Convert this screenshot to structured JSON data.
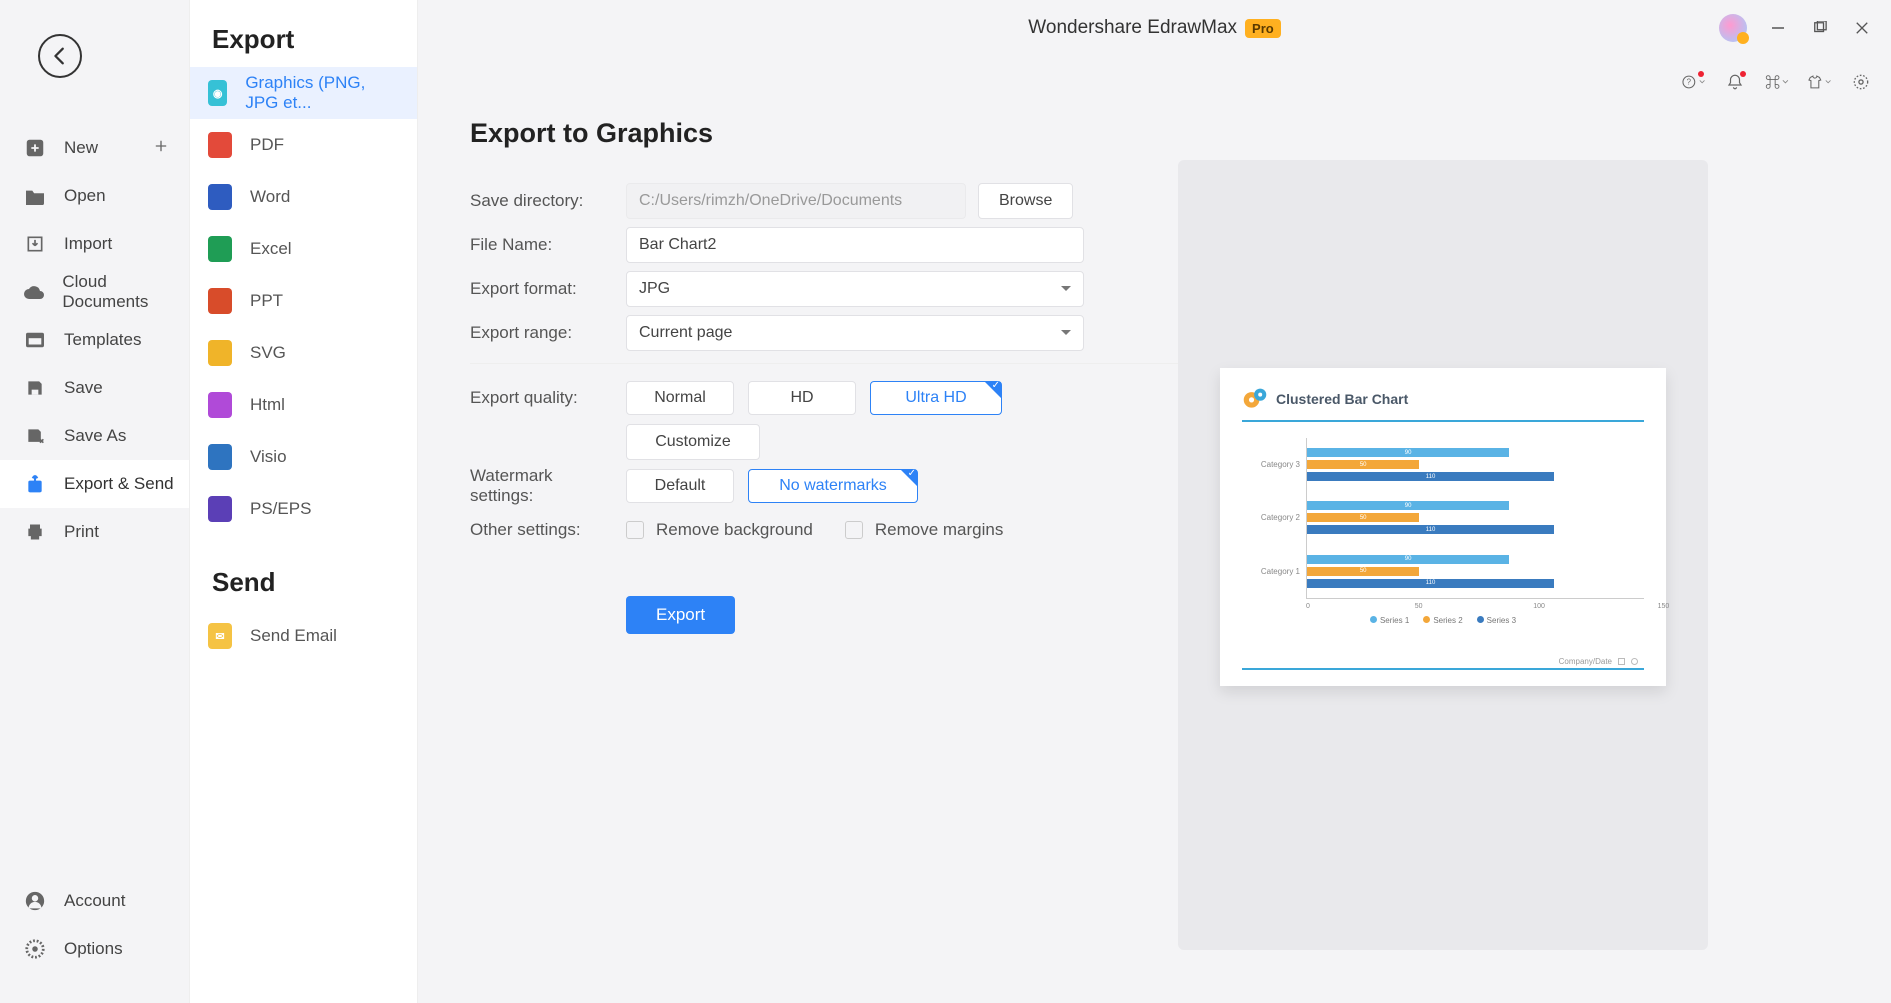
{
  "app": {
    "title": "Wondershare EdrawMax",
    "badge": "Pro"
  },
  "nav1": {
    "items": [
      {
        "key": "new",
        "label": "New"
      },
      {
        "key": "open",
        "label": "Open"
      },
      {
        "key": "import",
        "label": "Import"
      },
      {
        "key": "cloud",
        "label": "Cloud Documents"
      },
      {
        "key": "tmpl",
        "label": "Templates"
      },
      {
        "key": "save",
        "label": "Save"
      },
      {
        "key": "saveas",
        "label": "Save As"
      },
      {
        "key": "export",
        "label": "Export & Send"
      },
      {
        "key": "print",
        "label": "Print"
      }
    ],
    "bottom": [
      {
        "key": "account",
        "label": "Account"
      },
      {
        "key": "options",
        "label": "Options"
      }
    ]
  },
  "nav2": {
    "heading_export": "Export",
    "heading_send": "Send",
    "export_items": [
      {
        "k": "graphics",
        "label": "Graphics (PNG, JPG et..."
      },
      {
        "k": "pdf",
        "label": "PDF"
      },
      {
        "k": "word",
        "label": "Word"
      },
      {
        "k": "excel",
        "label": "Excel"
      },
      {
        "k": "ppt",
        "label": "PPT"
      },
      {
        "k": "svg",
        "label": "SVG"
      },
      {
        "k": "html",
        "label": "Html"
      },
      {
        "k": "visio",
        "label": "Visio"
      },
      {
        "k": "ps",
        "label": "PS/EPS"
      }
    ],
    "send_items": [
      {
        "k": "email",
        "label": "Send Email"
      }
    ]
  },
  "form": {
    "heading": "Export to Graphics",
    "labels": {
      "save_dir": "Save directory:",
      "file_name": "File Name:",
      "format": "Export format:",
      "range": "Export range:",
      "quality": "Export quality:",
      "watermark": "Watermark settings:",
      "other": "Other settings:"
    },
    "save_dir_value": "C:/Users/rimzh/OneDrive/Documents",
    "browse_btn": "Browse",
    "file_name_value": "Bar Chart2",
    "format_value": "JPG",
    "range_value": "Current page",
    "quality_options": {
      "normal": "Normal",
      "hd": "HD",
      "uhd": "Ultra HD"
    },
    "customize_btn": "Customize",
    "watermark_options": {
      "default": "Default",
      "none": "No watermarks"
    },
    "other_options": {
      "remove_bg": "Remove background",
      "remove_margins": "Remove margins"
    },
    "export_btn": "Export"
  },
  "preview": {
    "title": "Clustered Bar Chart",
    "legend": {
      "s1": "Series 1",
      "s2": "Series 2",
      "s3": "Series 3"
    },
    "footer": "Company/Date"
  },
  "chart_data": {
    "type": "bar",
    "orientation": "horizontal",
    "title": "Clustered Bar Chart",
    "categories": [
      "Category 3",
      "Category 2",
      "Category 1"
    ],
    "series": [
      {
        "name": "Series 1",
        "values": [
          90,
          90,
          90
        ],
        "color": "#5ab3e5"
      },
      {
        "name": "Series 2",
        "values": [
          50,
          50,
          50
        ],
        "color": "#f3a73a"
      },
      {
        "name": "Series 3",
        "values": [
          110,
          110,
          110
        ],
        "color": "#3a7bbf"
      }
    ],
    "xlabel": "",
    "ylabel": "",
    "xlim": [
      0,
      150
    ],
    "xticks": [
      0,
      50,
      100,
      150
    ],
    "legend_position": "bottom"
  }
}
